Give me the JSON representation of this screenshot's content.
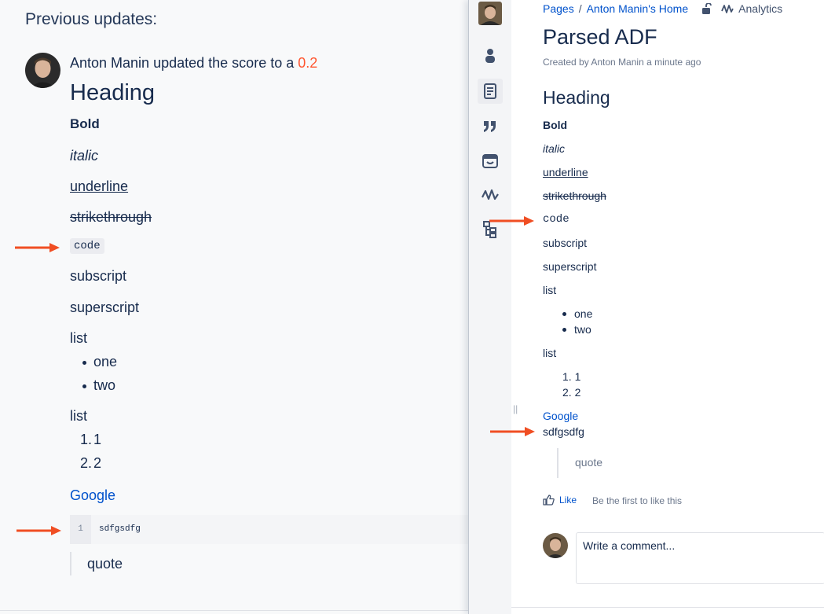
{
  "left": {
    "title": "Previous updates:",
    "update": {
      "author": "Anton Manin",
      "action": "updated the score to a",
      "score": "0.2"
    },
    "content": {
      "heading": "Heading",
      "bold": "Bold",
      "italic": "italic",
      "underline": "underline",
      "strike": "strikethrough",
      "code": "code",
      "subscript": "subscript",
      "superscript": "superscript",
      "list1_label": "list",
      "bullets": [
        "one",
        "two"
      ],
      "list2_label": "list",
      "numbered": [
        "1.",
        "1",
        "2.",
        "2"
      ],
      "link": "Google",
      "codeblock_line": "1",
      "codeblock": "sdfgsdfg",
      "quote": "quote"
    }
  },
  "right": {
    "breadcrumb": {
      "pages": "Pages",
      "sep": "/",
      "home": "Anton Manin's Home",
      "analytics": "Analytics"
    },
    "title": "Parsed ADF",
    "meta": "Created by Anton Manin a minute ago",
    "content": {
      "heading": "Heading",
      "bold": "Bold",
      "italic": "italic",
      "underline": "underline",
      "strike": "strikethrough",
      "code": "code",
      "subscript": "subscript",
      "superscript": "superscript",
      "list1_label": "list",
      "bullets": [
        "one",
        "two"
      ],
      "list2_label": "list",
      "numbered": [
        "1. 1",
        "2. 2"
      ],
      "link": "Google",
      "plain": "sdfgsdfg",
      "quote": "quote"
    },
    "like_label": "Like",
    "like_note": "Be the first to like this",
    "comment_placeholder": "Write a comment..."
  },
  "colors": {
    "link": "#0052cc",
    "score": "#ff5630",
    "arrow": "#f04e23"
  },
  "icons": [
    "person-icon",
    "page-icon",
    "quote-icon",
    "calendar-icon",
    "analytics-icon",
    "page-tree-icon",
    "unlock-icon",
    "like-icon"
  ]
}
